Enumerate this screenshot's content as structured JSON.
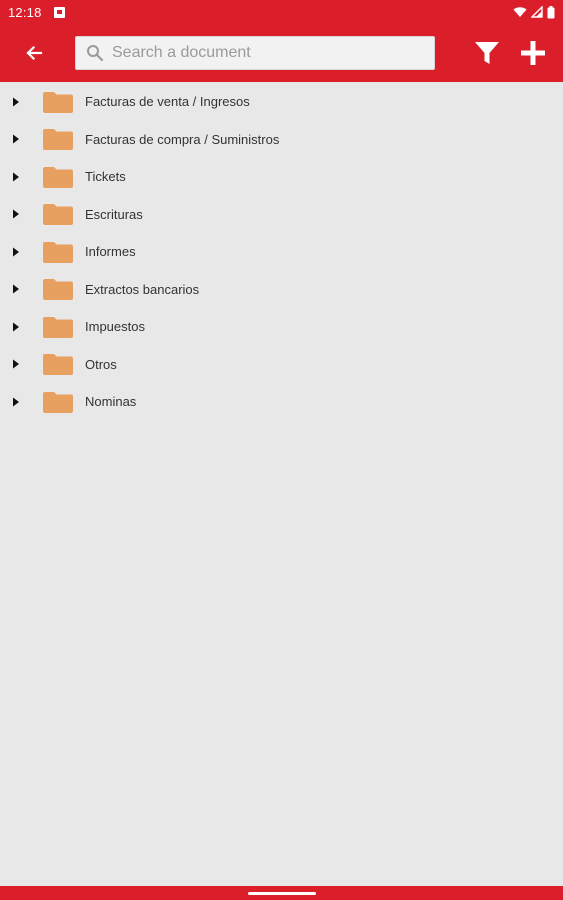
{
  "status_bar": {
    "time": "12:18"
  },
  "app_bar": {
    "back_icon": "arrow-back-icon",
    "search": {
      "placeholder": "Search a document",
      "value": ""
    },
    "filter_icon": "filter-icon",
    "add_icon": "plus-icon"
  },
  "folders": [
    {
      "label": "Facturas de venta / Ingresos"
    },
    {
      "label": "Facturas de compra / Suministros"
    },
    {
      "label": "Tickets"
    },
    {
      "label": "Escrituras"
    },
    {
      "label": "Informes"
    },
    {
      "label": "Extractos bancarios"
    },
    {
      "label": "Impuestos"
    },
    {
      "label": "Otros"
    },
    {
      "label": "Nominas"
    }
  ],
  "colors": {
    "brand_red": "#da1f2b",
    "folder_orange": "#e8a060",
    "background": "#e8e8e8"
  }
}
